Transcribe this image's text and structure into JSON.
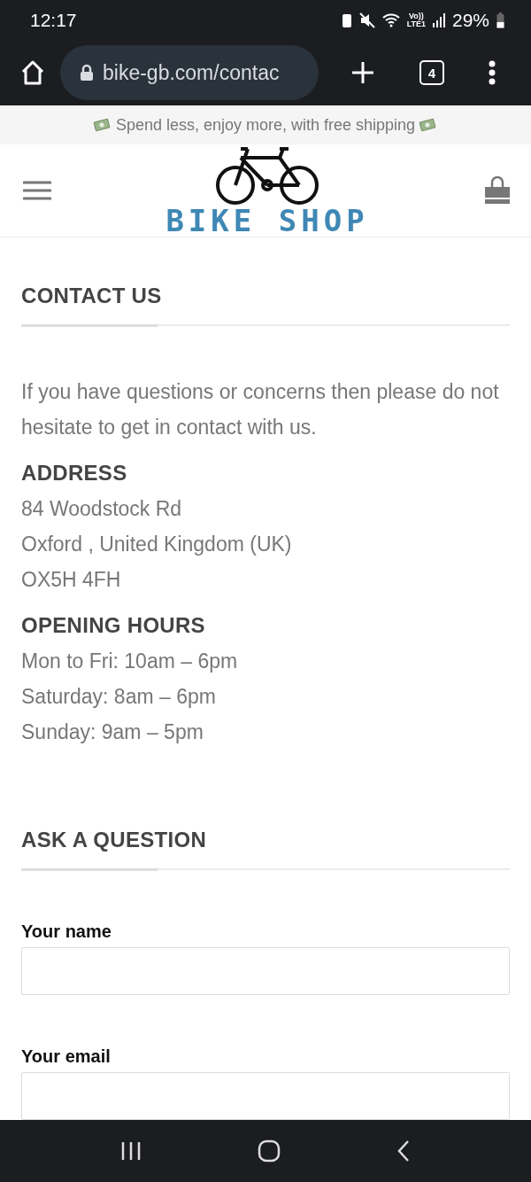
{
  "status_bar": {
    "time": "12:17",
    "network_top": "Vo))",
    "network_bottom": "LTE1",
    "battery": "29%"
  },
  "browser": {
    "url": "bike-gb.com/contac",
    "tab_count": "4"
  },
  "banner": {
    "text": "Spend less, enjoy more, with free shipping"
  },
  "header": {
    "logo_text": "BIKE SHOP"
  },
  "sections": [
    {
      "kind": "titled",
      "title": "CONTACT US"
    },
    {
      "kind": "paragraph",
      "text": "If you have questions or concerns then please do not hesitate to get in contact with us."
    },
    {
      "kind": "info",
      "title": "ADDRESS",
      "lines": [
        "84 Woodstock Rd",
        "Oxford , United Kingdom (UK)",
        "OX5H 4FH"
      ]
    },
    {
      "kind": "info",
      "title": "OPENING HOURS",
      "lines": [
        "Mon to Fri: 10am – 6pm",
        "Saturday: 8am – 6pm",
        "Sunday: 9am – 5pm"
      ]
    },
    {
      "kind": "titled",
      "title": "ASK A QUESTION"
    },
    {
      "kind": "field",
      "label": "Your name"
    },
    {
      "kind": "field",
      "label": "Your email"
    }
  ]
}
